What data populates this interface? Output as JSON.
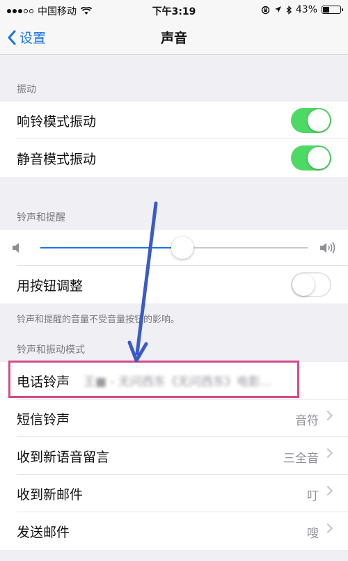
{
  "status_bar": {
    "carrier": "中国移动",
    "time": "下午3:19",
    "battery_text": "43%",
    "battery_level": 0.43
  },
  "nav": {
    "back_label": "设置",
    "title": "声音"
  },
  "vibrate": {
    "header": "振动",
    "ring_label": "响铃模式振动",
    "ring_on": true,
    "silent_label": "静音模式振动",
    "silent_on": true
  },
  "ringer": {
    "header": "铃声和提醒",
    "volume_level": 0.53,
    "change_with_buttons_label": "用按钮调整",
    "change_with_buttons_on": false,
    "footnote": "铃声和提醒的音量不受音量按钮的影响。"
  },
  "patterns": {
    "header": "铃声和振动模式",
    "items": [
      {
        "label": "电话铃声",
        "value": "王■ - 无问西东《无问西东》电影..."
      },
      {
        "label": "短信铃声",
        "value": "音符"
      },
      {
        "label": "收到新语音留言",
        "value": "三全音"
      },
      {
        "label": "收到新邮件",
        "value": "叮"
      },
      {
        "label": "发送邮件",
        "value": "嗖"
      }
    ]
  },
  "colors": {
    "toggle_on": "#4cd964",
    "accent": "#1a73e8",
    "annotation_box": "#d34b8c",
    "annotation_arrow": "#3a5bc7"
  },
  "icons": [
    "wifi-icon",
    "lock-rotation-icon",
    "location-icon",
    "bluetooth-icon",
    "battery-icon",
    "chevron-left-icon",
    "speaker-low-icon",
    "speaker-high-icon",
    "chevron-right-icon"
  ]
}
